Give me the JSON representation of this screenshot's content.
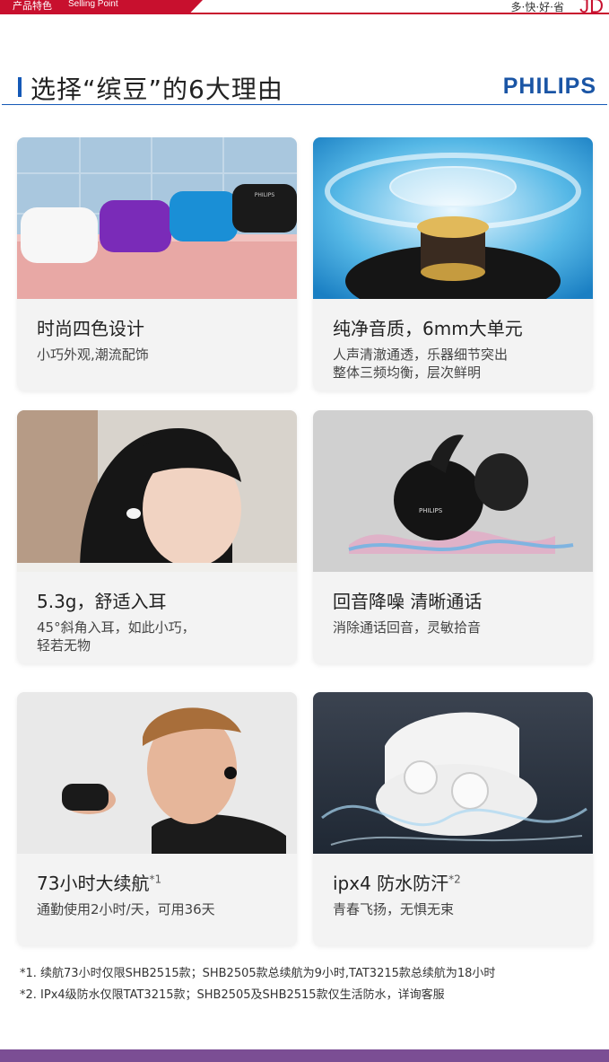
{
  "topbar": {
    "label_cn": "产品特色",
    "label_en": "Selling Point",
    "slogan": "多·快·好·省",
    "logo": "JD"
  },
  "heading": {
    "title": "选择“缤豆”的6大理由",
    "brand": "PHILIPS"
  },
  "cards": [
    {
      "title": "时尚四色设计",
      "note": "",
      "desc": "小巧外观,潮流配饰"
    },
    {
      "title": "纯净音质，6mm大单元",
      "note": "",
      "desc": "人声清澈通透，乐器细节突出\n整体三频均衡，层次鲜明"
    },
    {
      "title": "5.3g，舒适入耳",
      "note": "",
      "desc": "45°斜角入耳，如此小巧，\n轻若无物"
    },
    {
      "title": "回音降噪 清晰通话",
      "note": "",
      "desc": "消除通话回音，灵敏拾音"
    },
    {
      "title": "73小时大续航",
      "note": "*1",
      "desc": "通勤使用2小时/天，可用36天"
    },
    {
      "title": "ipx4 防水防汗",
      "note": "*2",
      "desc": "青春飞扬，无惧无束"
    }
  ],
  "photo_labels": {
    "case_brand": "PHILIPS",
    "bud_brand": "PHILIPS"
  },
  "footnotes": [
    "*1. 续航73小时仅限SHB2515款；SHB2505款总续航为9小时,TAT3215款总续航为18小时",
    "*2. IPx4级防水仅限TAT3215款；SHB2505及SHB2515款仅生活防水，详询客服"
  ],
  "colors": {
    "brand_blue": "#1a55a5",
    "jd_red": "#c8102e",
    "bottom_band": "#7b4e94"
  }
}
